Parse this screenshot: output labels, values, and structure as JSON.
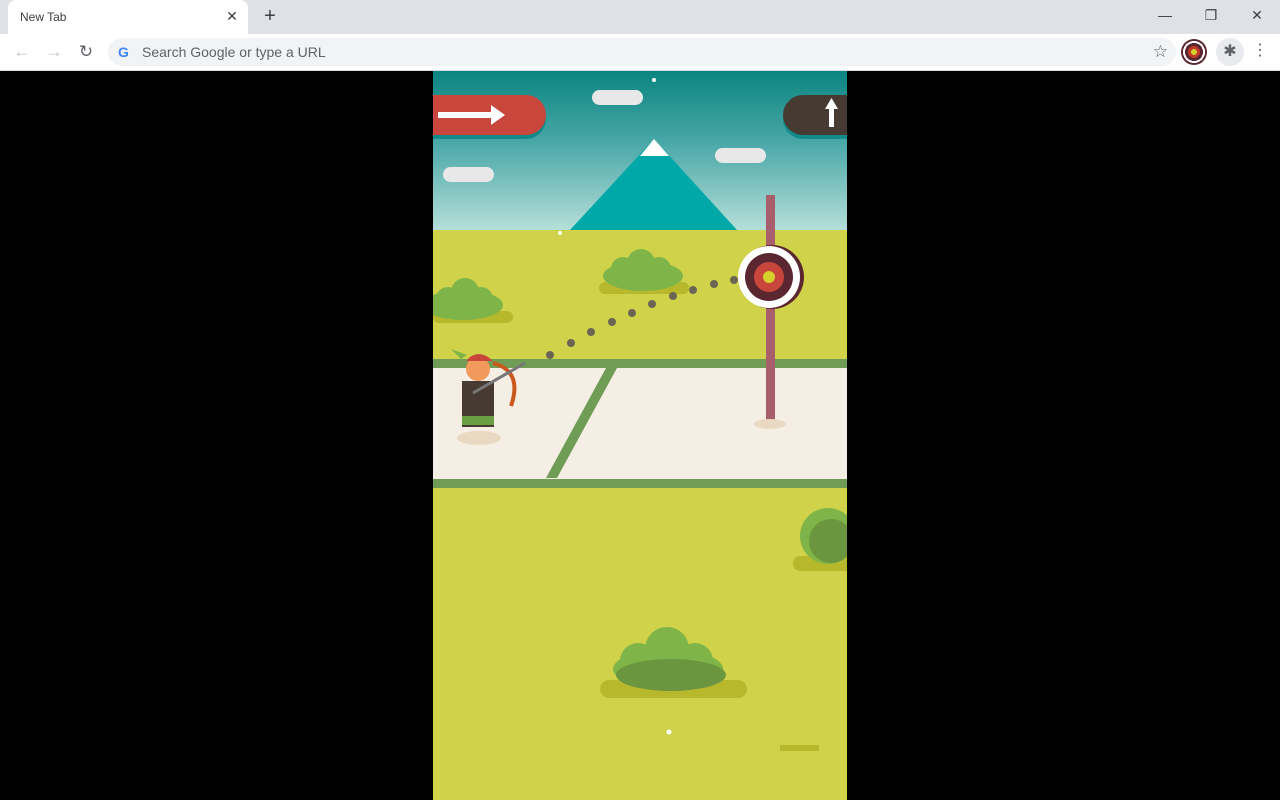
{
  "browser": {
    "tab_title": "New Tab",
    "tab_close": "✕",
    "new_tab": "+",
    "window_controls": {
      "minimize": "—",
      "restore": "❐",
      "close": "✕"
    },
    "nav": {
      "back": "←",
      "forward": "→",
      "reload": "↻"
    },
    "omnibox_placeholder": "Search Google or type a URL",
    "google_icon": "G",
    "bookmark_icon": "☆",
    "extension_puzzle_icon": "✱",
    "menu_icon": "⋮"
  },
  "game": {
    "left_button_icon": "arrow-right-icon",
    "right_button_icon": "arrow-up-icon",
    "colors": {
      "sky_top": "#0b8580",
      "grass": "#d0d24a",
      "court": "#f5eee4",
      "stripe": "#709d55",
      "target_red": "#c0392b",
      "target_dark": "#5a2630",
      "bullseye": "#d4d02c"
    }
  }
}
